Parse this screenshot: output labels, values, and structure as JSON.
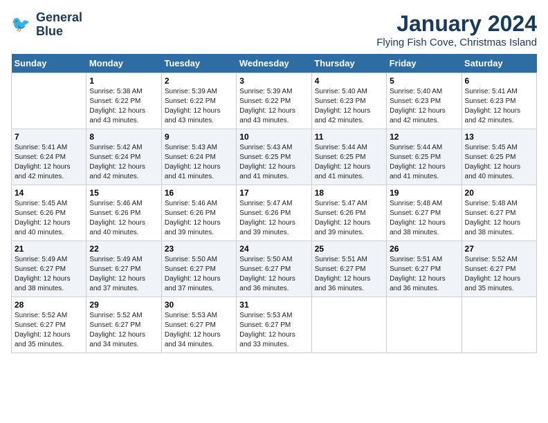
{
  "header": {
    "logo_line1": "General",
    "logo_line2": "Blue",
    "main_title": "January 2024",
    "subtitle": "Flying Fish Cove, Christmas Island"
  },
  "weekdays": [
    "Sunday",
    "Monday",
    "Tuesday",
    "Wednesday",
    "Thursday",
    "Friday",
    "Saturday"
  ],
  "weeks": [
    [
      {
        "day": "",
        "info": ""
      },
      {
        "day": "1",
        "info": "Sunrise: 5:38 AM\nSunset: 6:22 PM\nDaylight: 12 hours\nand 43 minutes."
      },
      {
        "day": "2",
        "info": "Sunrise: 5:39 AM\nSunset: 6:22 PM\nDaylight: 12 hours\nand 43 minutes."
      },
      {
        "day": "3",
        "info": "Sunrise: 5:39 AM\nSunset: 6:22 PM\nDaylight: 12 hours\nand 43 minutes."
      },
      {
        "day": "4",
        "info": "Sunrise: 5:40 AM\nSunset: 6:23 PM\nDaylight: 12 hours\nand 42 minutes."
      },
      {
        "day": "5",
        "info": "Sunrise: 5:40 AM\nSunset: 6:23 PM\nDaylight: 12 hours\nand 42 minutes."
      },
      {
        "day": "6",
        "info": "Sunrise: 5:41 AM\nSunset: 6:23 PM\nDaylight: 12 hours\nand 42 minutes."
      }
    ],
    [
      {
        "day": "7",
        "info": "Sunrise: 5:41 AM\nSunset: 6:24 PM\nDaylight: 12 hours\nand 42 minutes."
      },
      {
        "day": "8",
        "info": "Sunrise: 5:42 AM\nSunset: 6:24 PM\nDaylight: 12 hours\nand 42 minutes."
      },
      {
        "day": "9",
        "info": "Sunrise: 5:43 AM\nSunset: 6:24 PM\nDaylight: 12 hours\nand 41 minutes."
      },
      {
        "day": "10",
        "info": "Sunrise: 5:43 AM\nSunset: 6:25 PM\nDaylight: 12 hours\nand 41 minutes."
      },
      {
        "day": "11",
        "info": "Sunrise: 5:44 AM\nSunset: 6:25 PM\nDaylight: 12 hours\nand 41 minutes."
      },
      {
        "day": "12",
        "info": "Sunrise: 5:44 AM\nSunset: 6:25 PM\nDaylight: 12 hours\nand 41 minutes."
      },
      {
        "day": "13",
        "info": "Sunrise: 5:45 AM\nSunset: 6:25 PM\nDaylight: 12 hours\nand 40 minutes."
      }
    ],
    [
      {
        "day": "14",
        "info": "Sunrise: 5:45 AM\nSunset: 6:26 PM\nDaylight: 12 hours\nand 40 minutes."
      },
      {
        "day": "15",
        "info": "Sunrise: 5:46 AM\nSunset: 6:26 PM\nDaylight: 12 hours\nand 40 minutes."
      },
      {
        "day": "16",
        "info": "Sunrise: 5:46 AM\nSunset: 6:26 PM\nDaylight: 12 hours\nand 39 minutes."
      },
      {
        "day": "17",
        "info": "Sunrise: 5:47 AM\nSunset: 6:26 PM\nDaylight: 12 hours\nand 39 minutes."
      },
      {
        "day": "18",
        "info": "Sunrise: 5:47 AM\nSunset: 6:26 PM\nDaylight: 12 hours\nand 39 minutes."
      },
      {
        "day": "19",
        "info": "Sunrise: 5:48 AM\nSunset: 6:27 PM\nDaylight: 12 hours\nand 38 minutes."
      },
      {
        "day": "20",
        "info": "Sunrise: 5:48 AM\nSunset: 6:27 PM\nDaylight: 12 hours\nand 38 minutes."
      }
    ],
    [
      {
        "day": "21",
        "info": "Sunrise: 5:49 AM\nSunset: 6:27 PM\nDaylight: 12 hours\nand 38 minutes."
      },
      {
        "day": "22",
        "info": "Sunrise: 5:49 AM\nSunset: 6:27 PM\nDaylight: 12 hours\nand 37 minutes."
      },
      {
        "day": "23",
        "info": "Sunrise: 5:50 AM\nSunset: 6:27 PM\nDaylight: 12 hours\nand 37 minutes."
      },
      {
        "day": "24",
        "info": "Sunrise: 5:50 AM\nSunset: 6:27 PM\nDaylight: 12 hours\nand 36 minutes."
      },
      {
        "day": "25",
        "info": "Sunrise: 5:51 AM\nSunset: 6:27 PM\nDaylight: 12 hours\nand 36 minutes."
      },
      {
        "day": "26",
        "info": "Sunrise: 5:51 AM\nSunset: 6:27 PM\nDaylight: 12 hours\nand 36 minutes."
      },
      {
        "day": "27",
        "info": "Sunrise: 5:52 AM\nSunset: 6:27 PM\nDaylight: 12 hours\nand 35 minutes."
      }
    ],
    [
      {
        "day": "28",
        "info": "Sunrise: 5:52 AM\nSunset: 6:27 PM\nDaylight: 12 hours\nand 35 minutes."
      },
      {
        "day": "29",
        "info": "Sunrise: 5:52 AM\nSunset: 6:27 PM\nDaylight: 12 hours\nand 34 minutes."
      },
      {
        "day": "30",
        "info": "Sunrise: 5:53 AM\nSunset: 6:27 PM\nDaylight: 12 hours\nand 34 minutes."
      },
      {
        "day": "31",
        "info": "Sunrise: 5:53 AM\nSunset: 6:27 PM\nDaylight: 12 hours\nand 33 minutes."
      },
      {
        "day": "",
        "info": ""
      },
      {
        "day": "",
        "info": ""
      },
      {
        "day": "",
        "info": ""
      }
    ]
  ]
}
